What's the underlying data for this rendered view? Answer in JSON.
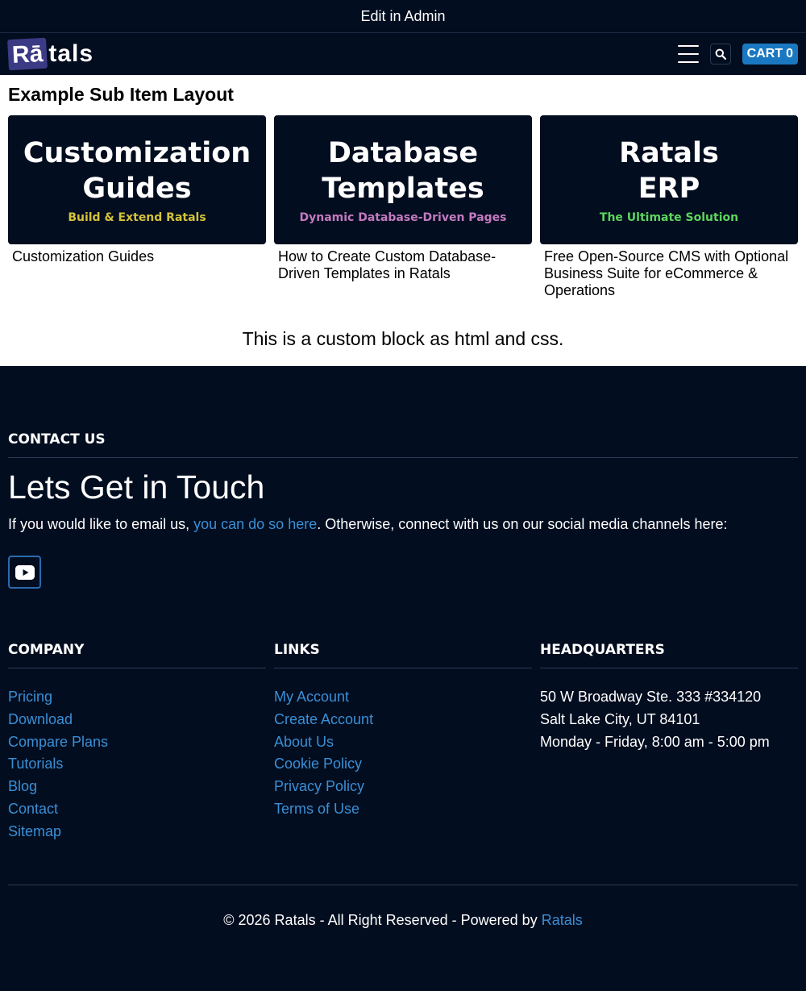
{
  "admin_bar": {
    "label": "Edit in Admin"
  },
  "header": {
    "logo_part1": "Rā",
    "logo_part2": "tals",
    "menu_icon": "hamburger-icon",
    "search_icon": "search-icon",
    "cart_label": "CART",
    "cart_count": "0",
    "colors": {
      "background": "#020d1f",
      "cart": "#1a78c2",
      "logo_box": "#3b3a85"
    }
  },
  "main": {
    "title": "Example Sub Item Layout",
    "cards": [
      {
        "line1": "Customization",
        "line2": "Guides",
        "sub": "Build & Extend Ratals",
        "sub_color": "#d4c23a",
        "caption": "Customization Guides"
      },
      {
        "line1": "Database",
        "line2": "Templates",
        "sub": "Dynamic Database-Driven Pages",
        "sub_color": "#c47ac0",
        "caption": "How to Create Custom Database-Driven Templates in Ratals"
      },
      {
        "line1": "Ratals",
        "line2": "ERP",
        "sub": "The Ultimate Solution",
        "sub_color": "#5cd65c",
        "caption": "Free Open-Source CMS with Optional Business Suite for eCommerce & Operations"
      }
    ],
    "custom_block": "This is a custom block as html and css."
  },
  "footer": {
    "contact_heading": "CONTACT US",
    "touch_title": "Lets Get in Touch",
    "touch_pre": "If you would like to email us, ",
    "touch_link": "you can do so here",
    "touch_post": ". Otherwise, connect with us on our social media channels here:",
    "social_icon": "youtube-icon",
    "company": {
      "title": "COMPANY",
      "links": [
        "Pricing",
        "Download",
        "Compare Plans",
        "Tutorials",
        "Blog",
        "Contact",
        "Sitemap"
      ]
    },
    "links": {
      "title": "LINKS",
      "links": [
        "My Account",
        "Create Account",
        "About Us",
        "Cookie Policy",
        "Privacy Policy",
        "Terms of Use"
      ]
    },
    "headquarters": {
      "title": "HEADQUARTERS",
      "lines": [
        "50 W Broadway Ste. 333 #334120",
        "Salt Lake City, UT 84101",
        "Monday - Friday, 8:00 am - 5:00 pm"
      ]
    },
    "copyright_text": "© 2026 Ratals - All Right Reserved - Powered by ",
    "copyright_link": "Ratals",
    "link_color": "#3a8fd6"
  }
}
